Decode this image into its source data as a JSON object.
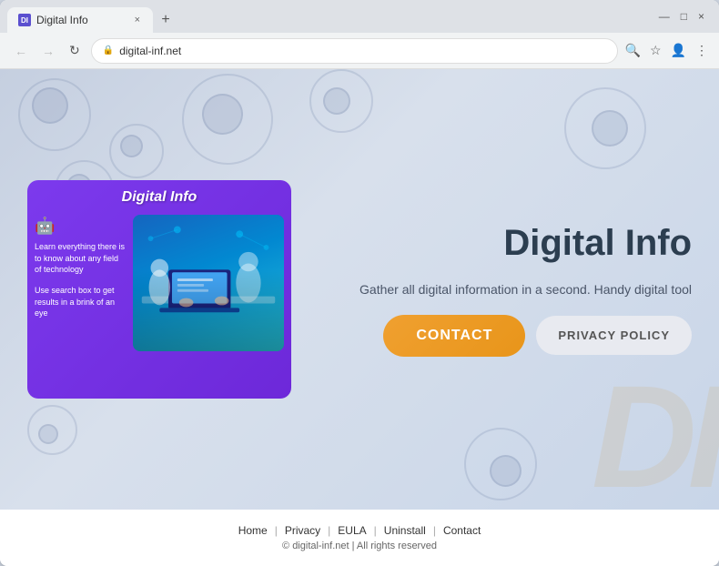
{
  "browser": {
    "tab_title": "Digital Info",
    "tab_favicon": "DI",
    "close_label": "×",
    "new_tab_label": "+",
    "window_minimize": "—",
    "window_maximize": "□",
    "window_close": "×",
    "nav_back": "←",
    "nav_forward": "→",
    "nav_refresh": "↻",
    "lock_icon": "🔒",
    "address_url": "digital-inf.net"
  },
  "page": {
    "app_title": "Digital Info",
    "app_subtitle": "Gather all digital information in a second. Handy digital tool",
    "promo_card_title": "Digital Info",
    "promo_text_1": "Learn everything there is to know about any field of technology",
    "promo_text_2": "Use search box to get results in a brink of an eye",
    "btn_contact": "CONTACT",
    "btn_privacy": "PRIVACY POLICY",
    "watermark": "DI"
  },
  "footer": {
    "links": [
      {
        "label": "Home"
      },
      {
        "label": "Privacy"
      },
      {
        "label": "EULA"
      },
      {
        "label": "Uninstall"
      },
      {
        "label": "Contact"
      }
    ],
    "copyright": "© digital-inf.net | All rights reserved"
  }
}
